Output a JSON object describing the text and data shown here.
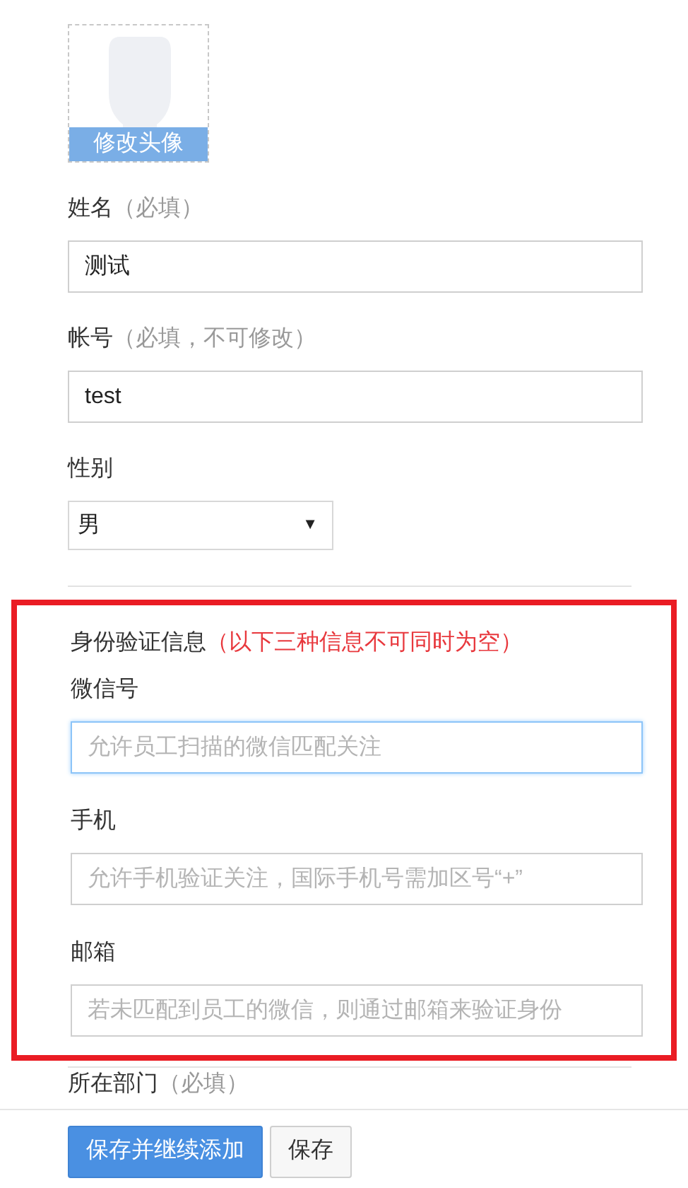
{
  "avatar": {
    "caption": "修改头像"
  },
  "fields": [
    {
      "kind": "text",
      "label": "姓名",
      "note": "（必填）",
      "value": "测试",
      "focused": false
    },
    {
      "kind": "text",
      "label": "帐号",
      "note": "（必填，不可修改）",
      "value": "test",
      "focused": false
    },
    {
      "kind": "select",
      "label": "性别",
      "value": "男",
      "caret": "▼"
    }
  ],
  "verification": {
    "title": "身份验证信息",
    "note": "（以下三种信息不可同时为空）",
    "highlighted": true,
    "fields": [
      {
        "label": "微信号",
        "placeholder": "允许员工扫描的微信匹配关注",
        "focused": true
      },
      {
        "label": "手机",
        "placeholder": "允许手机验证关注，国际手机号需加区号“+”",
        "focused": false
      },
      {
        "label": "邮箱",
        "placeholder": "若未匹配到员工的微信，则通过邮箱来验证身份",
        "focused": false
      }
    ]
  },
  "department": {
    "label": "所在部门",
    "note": "（必填）"
  },
  "buttons": [
    {
      "kind": "primary",
      "label": "保存并继续添加"
    },
    {
      "kind": "default",
      "label": "保存"
    }
  ]
}
